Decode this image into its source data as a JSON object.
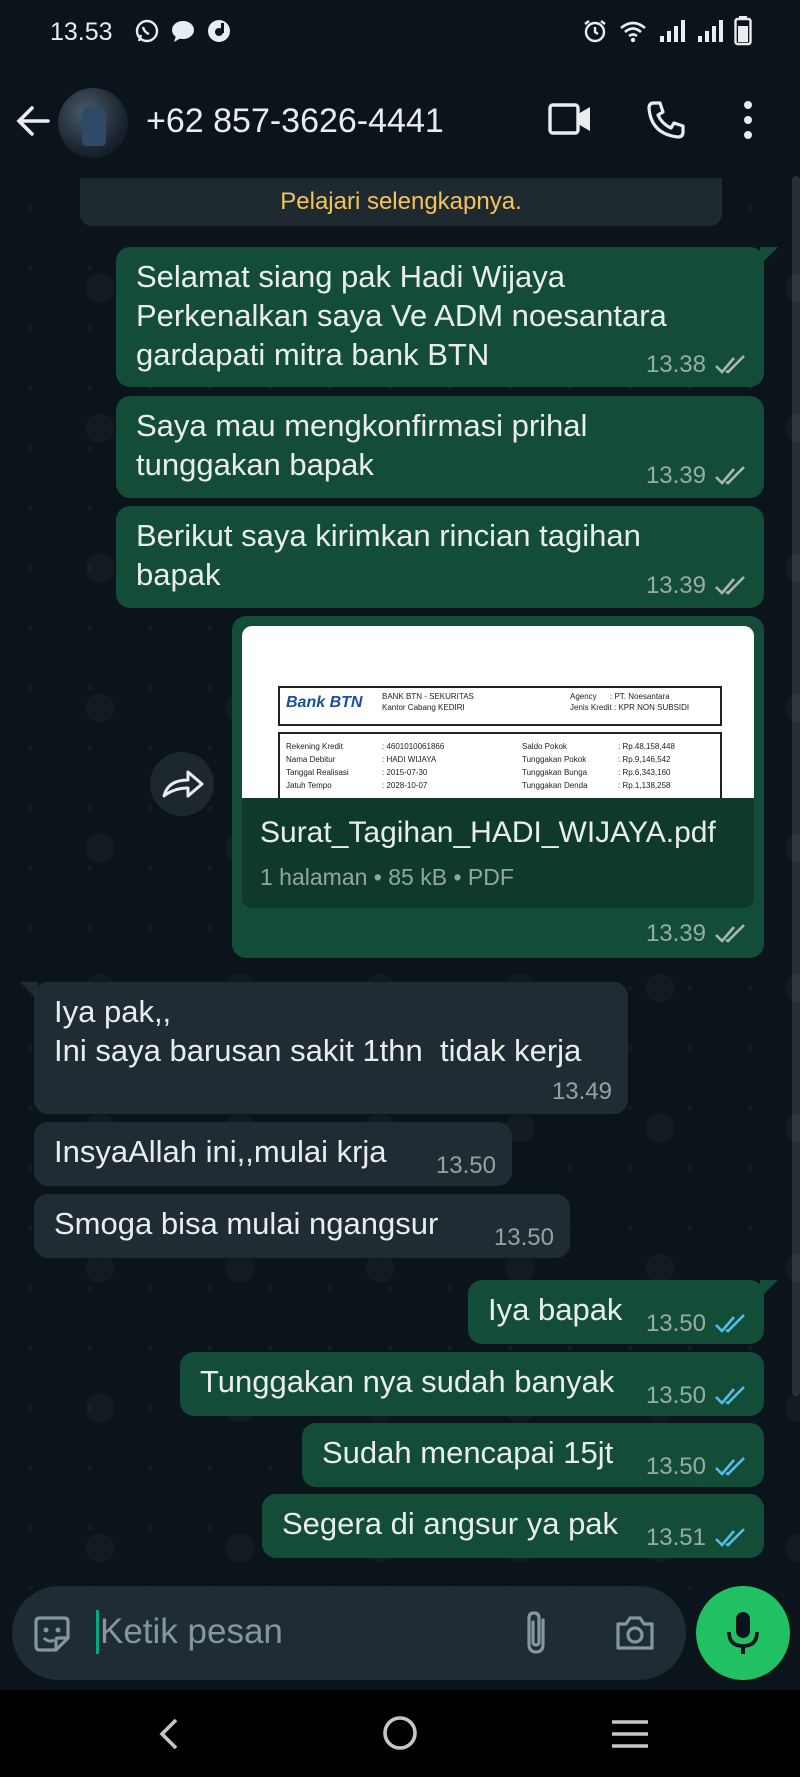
{
  "status_bar": {
    "time": "13.53"
  },
  "header": {
    "contact": "+62 857-3626-4441"
  },
  "system_notice": {
    "text": "Pelajari selengkapnya."
  },
  "messages": {
    "m1": {
      "text": "Selamat siang pak Hadi Wijaya\nPerkenalkan saya Ve ADM noesantara\ngardapati mitra bank BTN",
      "time": "13.38"
    },
    "m2": {
      "text": "Saya mau mengkonfirmasi prihal\ntunggakan bapak",
      "time": "13.39"
    },
    "m3": {
      "text": "Berikut saya kirimkan rincian tagihan\nbapak",
      "time": "13.39"
    },
    "doc": {
      "filename": "Surat_Tagihan_HADI_WIJAYA.pdf",
      "info": "1 halaman • 85 kB • PDF",
      "time": "13.39",
      "preview": {
        "bank_logo": "Bank BTN",
        "header_left_1": "BANK BTN - SEKURITAS",
        "header_left_2": "Kantor Cabang KEDIRI",
        "header_right_1": "Agency      : PT. Noesantara",
        "header_right_2": "Jenis Kredit : KPR NON SUBSIDI",
        "rows": [
          {
            "l": "Rekening Kredit",
            "lv": ": 4601010061866",
            "r": "Saldo Pokok",
            "rv": ": Rp.48,158,448"
          },
          {
            "l": "Nama Debitur",
            "lv": ": HADI WIJAYA",
            "r": "Tunggakan Pokok",
            "rv": ": Rp.9,146,542"
          },
          {
            "l": "Tanggal Realisasi",
            "lv": ": 2015-07-30",
            "r": "Tunggakan Bunga",
            "rv": ": Rp.6,343,160"
          },
          {
            "l": "Jatuh Tempo",
            "lv": ": 2028-10-07",
            "r": "Tunggakan Denda",
            "rv": ": Rp.1,138,258"
          }
        ]
      }
    },
    "m4": {
      "text": "Iya pak,,\nIni saya barusan sakit 1thn  tidak kerja",
      "time": "13.49"
    },
    "m5": {
      "text": "InsyaAllah ini,,mulai krja",
      "time": "13.50"
    },
    "m6": {
      "text": "Smoga bisa mulai ngangsur",
      "time": "13.50"
    },
    "m7": {
      "text": "Iya bapak",
      "time": "13.50"
    },
    "m8": {
      "text": "Tunggakan nya sudah banyak",
      "time": "13.50"
    },
    "m9": {
      "text": "Sudah mencapai 15jt",
      "time": "13.50"
    },
    "m10": {
      "text": "Segera di angsur ya pak",
      "time": "13.51"
    }
  },
  "composer": {
    "placeholder": "Ketik pesan"
  },
  "colors": {
    "outgoing": "#144d37",
    "incoming": "#202c33",
    "read_tick": "#53bdeb",
    "accent": "#21c063"
  }
}
